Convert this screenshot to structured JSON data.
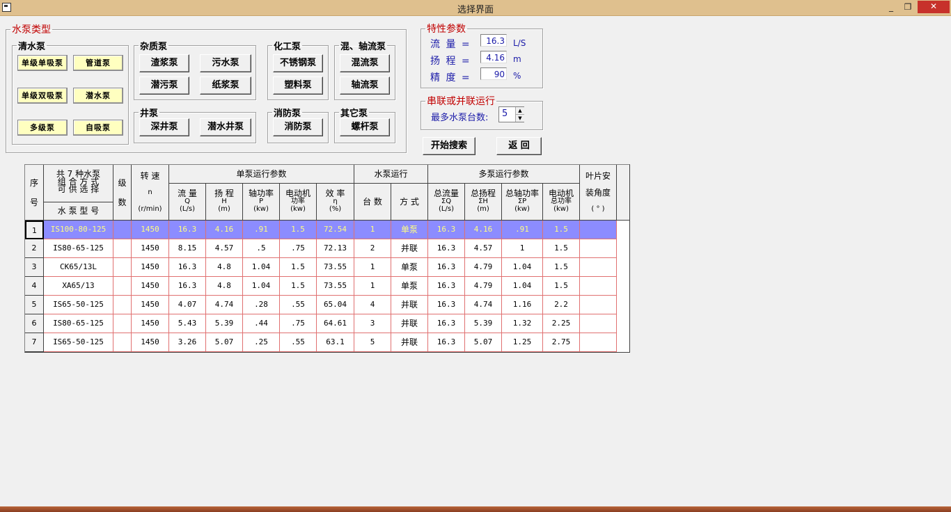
{
  "window": {
    "title": "选择界面",
    "min": "_",
    "max": "❐",
    "close": "✕"
  },
  "pump_type": {
    "legend": "水泵类型",
    "clear_water": {
      "legend": "清水泵",
      "buttons": [
        "单级单吸泵",
        "管道泵",
        "单级双吸泵",
        "潜水泵",
        "多级泵",
        "自吸泵"
      ]
    },
    "misc": {
      "legend": "杂质泵",
      "buttons": [
        "渣浆泵",
        "污水泵",
        "潜污泵",
        "纸浆泵"
      ]
    },
    "chemical": {
      "legend": "化工泵",
      "buttons": [
        "不锈钢泵",
        "塑料泵"
      ]
    },
    "mixed": {
      "legend": "混、轴流泵",
      "buttons": [
        "混流泵",
        "轴流泵"
      ]
    },
    "well": {
      "legend": "井泵",
      "buttons": [
        "深井泵",
        "潜水井泵"
      ]
    },
    "fire": {
      "legend": "消防泵",
      "buttons": [
        "消防泵"
      ]
    },
    "other": {
      "legend": "其它泵",
      "buttons": [
        "螺杆泵"
      ]
    }
  },
  "params": {
    "legend": "特性参数",
    "flow": {
      "label": "流 量 =",
      "value": "16.3",
      "unit": "L/S"
    },
    "head": {
      "label": "扬 程 =",
      "value": "4.16",
      "unit": "m"
    },
    "precision": {
      "label": "精 度 =",
      "value": "90",
      "unit": "%"
    }
  },
  "series": {
    "legend": "串联或并联运行",
    "label": "最多水泵台数:",
    "value": "5"
  },
  "actions": {
    "search": "开始搜索",
    "back": "返 回"
  },
  "table": {
    "h_seq": [
      "序",
      "号"
    ],
    "h_combo": [
      "共 7 种水泵",
      "组 合 方 式",
      "可 供 选 择"
    ],
    "h_model": "水 泵 型 号",
    "h_stage": [
      "级",
      "数"
    ],
    "h_speed": [
      "转 速",
      "n",
      "(r/min)"
    ],
    "h_single": "单泵运行参数",
    "h_pumprun": "水泵运行",
    "h_multi": "多泵运行参数",
    "h_blade": [
      "叶片安",
      "装角度",
      "( ° )"
    ],
    "sub": [
      [
        "流 量",
        "Q",
        "(L/s)"
      ],
      [
        "扬 程",
        "H",
        "(m)"
      ],
      [
        "轴功率",
        "P",
        "(kw)"
      ],
      [
        "电动机",
        "功率",
        "(kw)"
      ],
      [
        "效 率",
        "η",
        "(%)"
      ],
      [
        "台 数"
      ],
      [
        "方 式"
      ],
      [
        "总流量",
        "ΣQ",
        "(L/s)"
      ],
      [
        "总扬程",
        "ΣH",
        "(m)"
      ],
      [
        "总轴功率",
        "ΣP",
        "(kw)"
      ],
      [
        "电动机",
        "总功率",
        "(kw)"
      ]
    ],
    "rows": [
      [
        "1",
        "IS100-80-125",
        "",
        "1450",
        "16.3",
        "4.16",
        ".91",
        "1.5",
        "72.54",
        "1",
        "单泵",
        "16.3",
        "4.16",
        ".91",
        "1.5",
        ""
      ],
      [
        "2",
        "IS80-65-125",
        "",
        "1450",
        "8.15",
        "4.57",
        ".5",
        ".75",
        "72.13",
        "2",
        "并联",
        "16.3",
        "4.57",
        "1",
        "1.5",
        ""
      ],
      [
        "3",
        "CK65/13L",
        "",
        "1450",
        "16.3",
        "4.8",
        "1.04",
        "1.5",
        "73.55",
        "1",
        "单泵",
        "16.3",
        "4.79",
        "1.04",
        "1.5",
        ""
      ],
      [
        "4",
        "XA65/13",
        "",
        "1450",
        "16.3",
        "4.8",
        "1.04",
        "1.5",
        "73.55",
        "1",
        "单泵",
        "16.3",
        "4.79",
        "1.04",
        "1.5",
        ""
      ],
      [
        "5",
        "IS65-50-125",
        "",
        "1450",
        "4.07",
        "4.74",
        ".28",
        ".55",
        "65.04",
        "4",
        "并联",
        "16.3",
        "4.74",
        "1.16",
        "2.2",
        ""
      ],
      [
        "6",
        "IS80-65-125",
        "",
        "1450",
        "5.43",
        "5.39",
        ".44",
        ".75",
        "64.61",
        "3",
        "并联",
        "16.3",
        "5.39",
        "1.32",
        "2.25",
        ""
      ],
      [
        "7",
        "IS65-50-125",
        "",
        "1450",
        "3.26",
        "5.07",
        ".25",
        ".55",
        "63.1",
        "5",
        "并联",
        "16.3",
        "5.07",
        "1.25",
        "2.75",
        ""
      ]
    ]
  }
}
